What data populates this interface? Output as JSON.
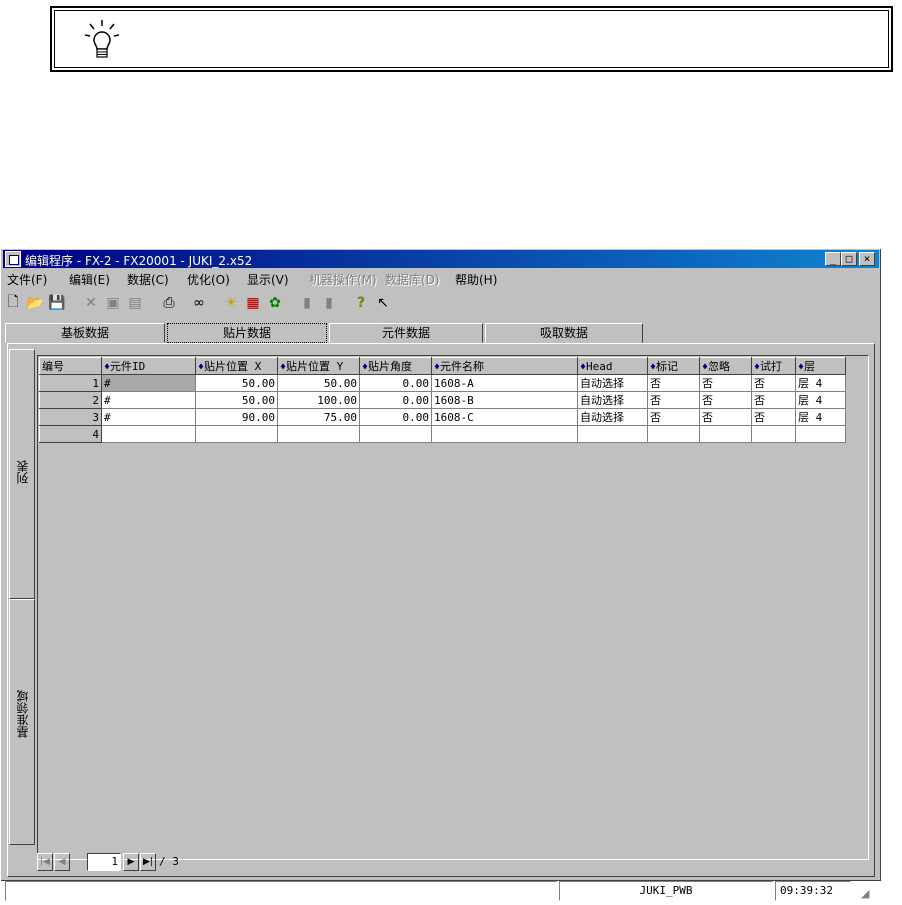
{
  "window": {
    "title": "编辑程序 - FX-2 - FX20001 - JUKI_2.x52",
    "controls": {
      "minimize": "_",
      "maximize": "□",
      "close": "×"
    }
  },
  "menu": [
    {
      "label": "文件(F)",
      "enabled": true
    },
    {
      "label": "编辑(E)",
      "enabled": true
    },
    {
      "label": "数据(C)",
      "enabled": true
    },
    {
      "label": "优化(O)",
      "enabled": true
    },
    {
      "label": "显示(V)",
      "enabled": true
    },
    {
      "label": "机器操作(M)",
      "enabled": false
    },
    {
      "label": "数据库(D)",
      "enabled": false
    },
    {
      "label": "帮助(H)",
      "enabled": true
    }
  ],
  "toolbar": {
    "icons": [
      "new-file-icon",
      "open-folder-icon",
      "save-disk-icon",
      "cut-icon",
      "copy-icon",
      "paste-icon",
      "print-icon",
      "find-binoculars-icon",
      "lightbulb-icon",
      "optimize-icon",
      "components-icon",
      "disabled-tool-1-icon",
      "disabled-tool-2-icon",
      "help-icon",
      "context-help-icon"
    ]
  },
  "tabs": [
    {
      "label": "基板数据",
      "active": false
    },
    {
      "label": "贴片数据",
      "active": true
    },
    {
      "label": "元件数据",
      "active": false
    },
    {
      "label": "吸取数据",
      "active": false
    }
  ],
  "side_tabs": {
    "list": "列表",
    "reference_area": "基准领域"
  },
  "table": {
    "columns": [
      "编号",
      "元件ID",
      "贴片位置 X",
      "贴片位置 Y",
      "贴片角度",
      "元件名称",
      "Head",
      "标记",
      "忽略",
      "试打",
      "层"
    ],
    "rows": [
      {
        "no": "1",
        "id": "#",
        "x": "50.00",
        "y": "50.00",
        "angle": "0.00",
        "name": "1608-A",
        "head": "自动选择",
        "mark": "否",
        "skip": "否",
        "test": "否",
        "layer": "层 4"
      },
      {
        "no": "2",
        "id": "#",
        "x": "50.00",
        "y": "100.00",
        "angle": "0.00",
        "name": "1608-B",
        "head": "自动选择",
        "mark": "否",
        "skip": "否",
        "test": "否",
        "layer": "层 4"
      },
      {
        "no": "3",
        "id": "#",
        "x": "90.00",
        "y": "75.00",
        "angle": "0.00",
        "name": "1608-C",
        "head": "自动选择",
        "mark": "否",
        "skip": "否",
        "test": "否",
        "layer": "层 4"
      },
      {
        "no": "4",
        "id": "",
        "x": "",
        "y": "",
        "angle": "",
        "name": "",
        "head": "",
        "mark": "",
        "skip": "",
        "test": "",
        "layer": ""
      }
    ]
  },
  "pager": {
    "current": "1",
    "total": "/ 3"
  },
  "status": {
    "library": "JUKI_PWB",
    "time": "09:39:32"
  }
}
